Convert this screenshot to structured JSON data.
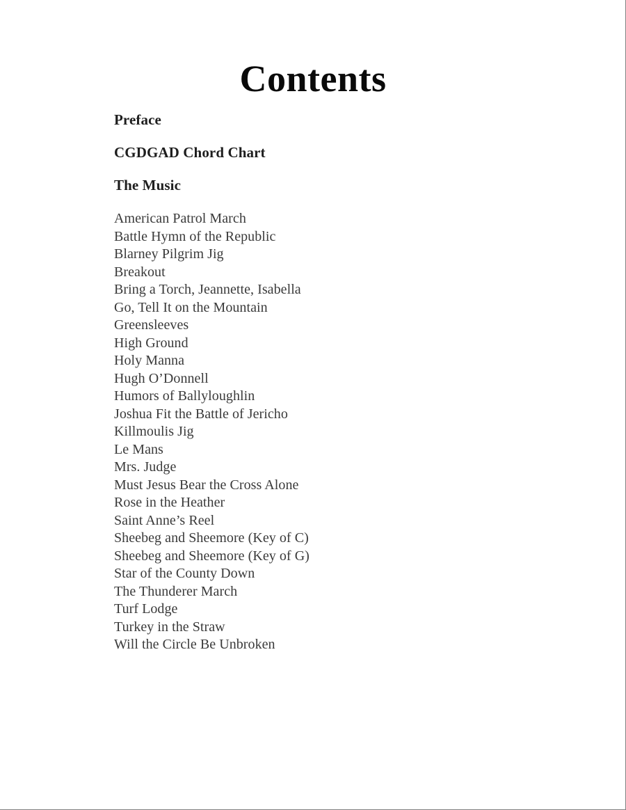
{
  "document": {
    "title": "Contents",
    "sections": [
      {
        "label": "Preface"
      },
      {
        "label": "CGDGAD Chord Chart"
      },
      {
        "label": "The Music"
      }
    ],
    "tunes": [
      "American Patrol March",
      "Battle Hymn of the Republic",
      "Blarney Pilgrim Jig",
      "Breakout",
      "Bring a Torch, Jeannette, Isabella",
      "Go, Tell It on the Mountain",
      "Greensleeves",
      "High Ground",
      "Holy Manna",
      "Hugh O’Donnell",
      "Humors of Ballyloughlin",
      "Joshua Fit the Battle of Jericho",
      "Killmoulis Jig",
      "Le Mans",
      "Mrs. Judge",
      "Must Jesus Bear the Cross Alone",
      "Rose in the Heather",
      "Saint Anne’s Reel",
      "Sheebeg and Sheemore (Key of C)",
      "Sheebeg and Sheemore (Key of G)",
      "Star of the County Down",
      "The Thunderer March",
      "Turf Lodge",
      "Turkey in the Straw",
      "Will the Circle Be Unbroken"
    ]
  },
  "colors": {
    "title": "#0a0a0a",
    "heading": "#1e1e1e",
    "body": "#3a3a3a",
    "page_border": "#808080",
    "background": "#ffffff"
  }
}
